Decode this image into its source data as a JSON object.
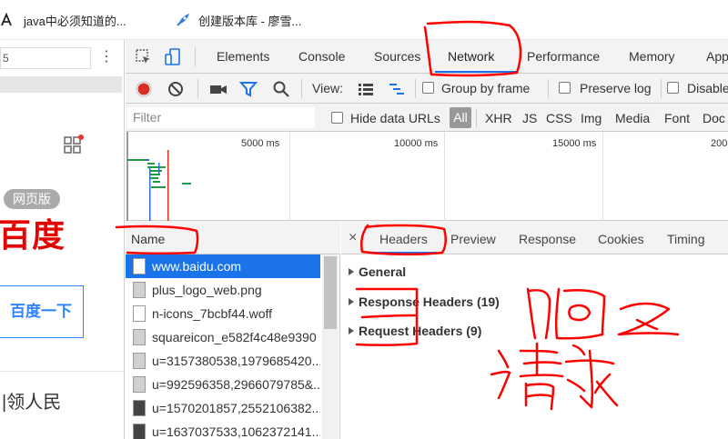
{
  "bookmarks": [
    {
      "label": "java中必须知道的...",
      "icon": "font-icon"
    },
    {
      "label": "创建版本库 - 廖雪...",
      "icon": "rocket-icon"
    }
  ],
  "left_page": {
    "address_value": "5",
    "kebab": "⋮",
    "web_badge": "网页版",
    "logo_text": "百度",
    "search_button": "百度一下",
    "news_text": "|领人民"
  },
  "devtools": {
    "tabs": [
      "Elements",
      "Console",
      "Sources",
      "Network",
      "Performance",
      "Memory",
      "App"
    ],
    "active_tab": "Network",
    "toolbar": {
      "view_label": "View:",
      "group_by_frame": "Group by frame",
      "preserve_log": "Preserve log",
      "disable_cache": "Disable"
    },
    "filter": {
      "placeholder": "Filter",
      "hide_data_urls": "Hide data URLs",
      "all": "All",
      "types": [
        "XHR",
        "JS",
        "CSS",
        "Img",
        "Media",
        "Font",
        "Doc"
      ]
    },
    "overview_ticks": [
      "5000 ms",
      "10000 ms",
      "15000 ms",
      "200"
    ],
    "requests": {
      "header": "Name",
      "rows": [
        {
          "name": "www.baidu.com",
          "selected": true,
          "icon": "doc"
        },
        {
          "name": "plus_logo_web.png",
          "icon": "img"
        },
        {
          "name": "n-icons_7bcbf44.woff",
          "icon": "doc"
        },
        {
          "name": "squareicon_e582f4c48e9390",
          "icon": "img"
        },
        {
          "name": "u=3157380538,1979685420...",
          "icon": "img"
        },
        {
          "name": "u=992596358,2966079785&...",
          "icon": "img"
        },
        {
          "name": "u=1570201857,2552106382...",
          "icon": "dark"
        },
        {
          "name": "u=1637037533,1062372141...",
          "icon": "dark"
        }
      ]
    },
    "details": {
      "close": "×",
      "tabs": [
        "Headers",
        "Preview",
        "Response",
        "Cookies",
        "Timing"
      ],
      "active_tab": "Headers",
      "sections": [
        "General",
        "Response Headers (19)",
        "Request Headers (9)"
      ]
    }
  },
  "colors": {
    "accent": "#1a73e8",
    "record": "#d93025",
    "annotation": "#ff0000",
    "baidu_red": "#e10602"
  }
}
